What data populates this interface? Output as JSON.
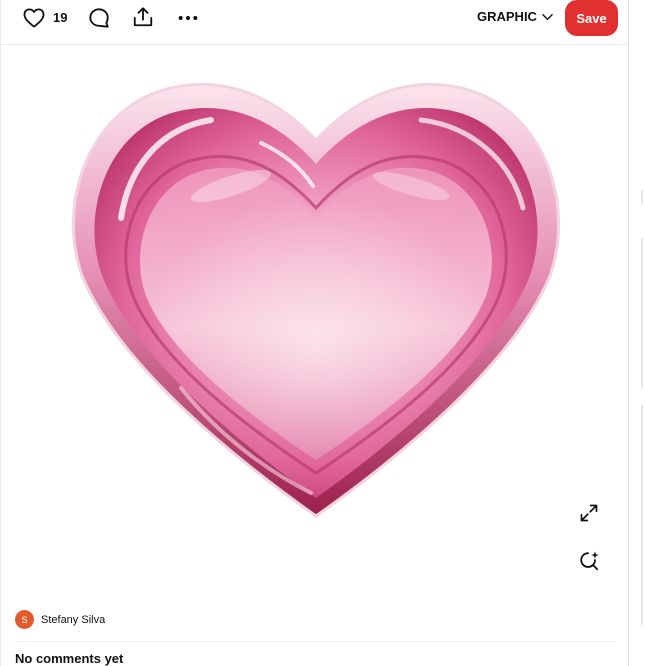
{
  "toolbar": {
    "like_count": "19",
    "type_label": "GRAPHIC",
    "save_label": "Save"
  },
  "pin": {
    "image_alt": "Glossy pink glass heart",
    "author_name": "Stefany Silva",
    "author_initial": "S"
  },
  "comments": {
    "status": "No comments yet"
  },
  "colors": {
    "save_button": "#e0302f",
    "avatar": "#e15b2f",
    "heart_main": "#e879a8"
  },
  "icons": [
    "heart-outline-icon",
    "comment-icon",
    "share-icon",
    "more-icon",
    "chevron-down-icon",
    "expand-icon",
    "visual-search-icon"
  ]
}
